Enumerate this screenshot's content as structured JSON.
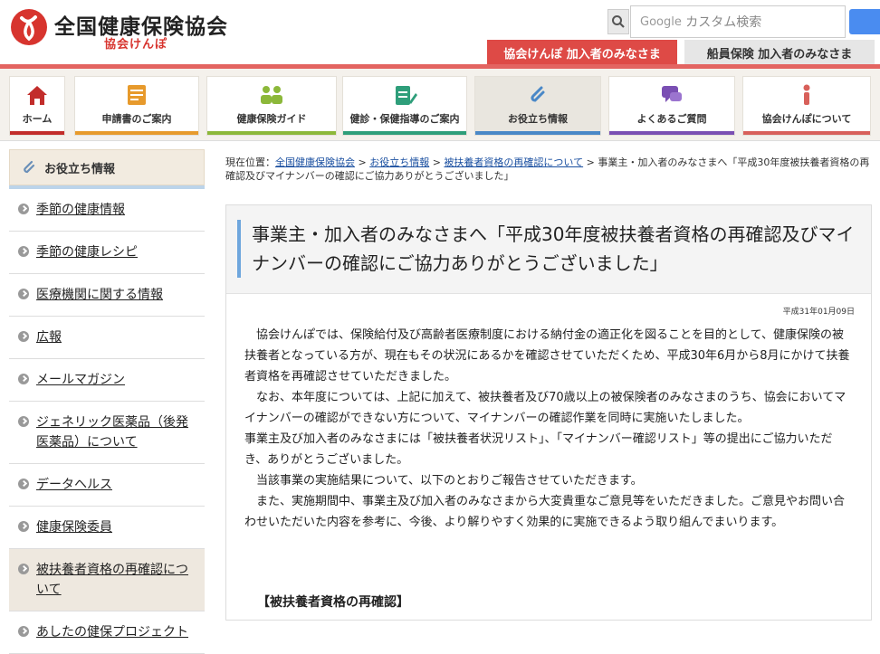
{
  "header": {
    "site_title": "全国健康保険協会",
    "site_sub": "協会けんぽ",
    "search": {
      "brand": "Google",
      "placeholder": "カスタム検索"
    },
    "tab_kyokai": "協会けんぽ 加入者のみなさま",
    "tab_senin": "船員保険 加入者のみなさま",
    "accent_color": "#de4a46"
  },
  "gnav": [
    {
      "label": "ホーム",
      "icon": "home-icon",
      "color": "#c22d2b"
    },
    {
      "label": "申請書のご案内",
      "icon": "document-icon",
      "color": "#e79a2c"
    },
    {
      "label": "健康保険ガイド",
      "icon": "people-icon",
      "color": "#8cb83a"
    },
    {
      "label": "健診・保健指導のご案内",
      "icon": "clipboard-pencil-icon",
      "color": "#2e9e7a"
    },
    {
      "label": "お役立ち情報",
      "icon": "paperclip-icon",
      "color": "#4a88c7"
    },
    {
      "label": "よくあるご質問",
      "icon": "speech-bubble-icon",
      "color": "#7a4fb3"
    },
    {
      "label": "協会けんぽについて",
      "icon": "info-person-icon",
      "color": "#d8605a"
    }
  ],
  "sidebar": {
    "heading": "お役立ち情報",
    "items": [
      {
        "label": "季節の健康情報"
      },
      {
        "label": "季節の健康レシピ"
      },
      {
        "label": "医療機関に関する情報"
      },
      {
        "label": "広報"
      },
      {
        "label": "メールマガジン"
      },
      {
        "label": "ジェネリック医薬品（後発医薬品）について"
      },
      {
        "label": "データヘルス"
      },
      {
        "label": "健康保険委員"
      },
      {
        "label": "被扶養者資格の再確認について"
      },
      {
        "label": "あしたの健保プロジェクト"
      }
    ]
  },
  "breadcrumb": {
    "prefix": "現在位置：",
    "links": [
      "全国健康保険協会",
      "お役立ち情報",
      "被扶養者資格の再確認について"
    ],
    "current": "事業主・加入者のみなさまへ「平成30年度被扶養者資格の再確認及びマイナンバーの確認にご協力ありがとうございました」"
  },
  "article": {
    "title": "事業主・加入者のみなさまへ「平成30年度被扶養者資格の再確認及びマイナンバーの確認にご協力ありがとうございました」",
    "date": "平成31年01月09日",
    "paragraphs": [
      "協会けんぽでは、保険給付及び高齢者医療制度における納付金の適正化を図ることを目的として、健康保険の被扶養者となっている方が、現在もその状況にあるかを確認させていただくため、平成30年6月から8月にかけて扶養者資格を再確認させていただきました。",
      "なお、本年度については、上記に加えて、被扶養者及び70歳以上の被保険者のみなさまのうち、協会においてマイナンバーの確認ができない方について、マイナンバーの確認作業を同時に実施いたしました。",
      "事業主及び加入者のみなさまには「被扶養者状況リスト」、「マイナンバー確認リスト」等の提出にご協力いただき、ありがとうございました。",
      "当該事業の実施結果について、以下のとおりご報告させていただきます。",
      "また、実施期間中、事業主及び加入者のみなさまから大変貴重なご意見等をいただきました。ご意見やお問い合わせいただいた内容を参考に、今後、より解りやすく効果的に実施できるよう取り組んでまいります。"
    ],
    "section_heading": "【被扶養者資格の再確認】"
  }
}
